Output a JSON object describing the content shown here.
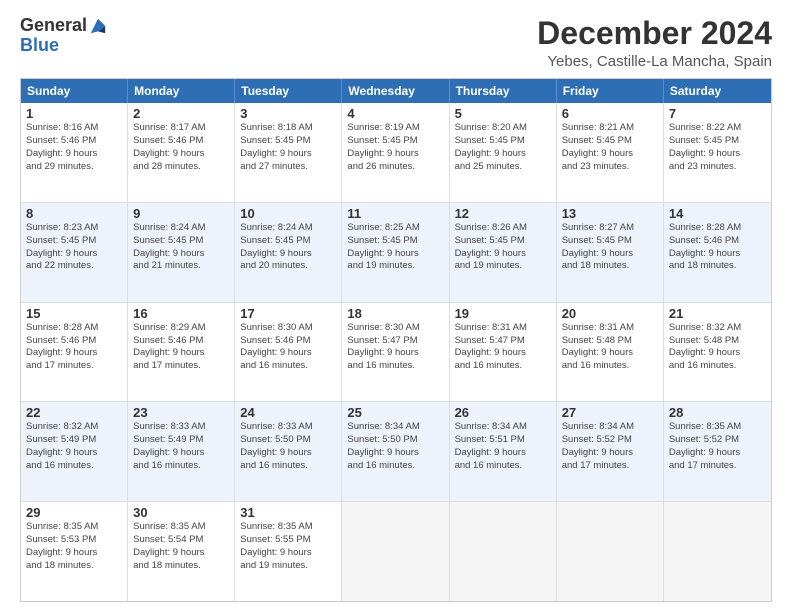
{
  "logo": {
    "line1": "General",
    "line2": "Blue"
  },
  "title": "December 2024",
  "subtitle": "Yebes, Castille-La Mancha, Spain",
  "header": {
    "days": [
      "Sunday",
      "Monday",
      "Tuesday",
      "Wednesday",
      "Thursday",
      "Friday",
      "Saturday"
    ]
  },
  "weeks": [
    {
      "alt": false,
      "cells": [
        {
          "day": "1",
          "info": "Sunrise: 8:16 AM\nSunset: 5:46 PM\nDaylight: 9 hours\nand 29 minutes."
        },
        {
          "day": "2",
          "info": "Sunrise: 8:17 AM\nSunset: 5:46 PM\nDaylight: 9 hours\nand 28 minutes."
        },
        {
          "day": "3",
          "info": "Sunrise: 8:18 AM\nSunset: 5:45 PM\nDaylight: 9 hours\nand 27 minutes."
        },
        {
          "day": "4",
          "info": "Sunrise: 8:19 AM\nSunset: 5:45 PM\nDaylight: 9 hours\nand 26 minutes."
        },
        {
          "day": "5",
          "info": "Sunrise: 8:20 AM\nSunset: 5:45 PM\nDaylight: 9 hours\nand 25 minutes."
        },
        {
          "day": "6",
          "info": "Sunrise: 8:21 AM\nSunset: 5:45 PM\nDaylight: 9 hours\nand 23 minutes."
        },
        {
          "day": "7",
          "info": "Sunrise: 8:22 AM\nSunset: 5:45 PM\nDaylight: 9 hours\nand 23 minutes."
        }
      ]
    },
    {
      "alt": true,
      "cells": [
        {
          "day": "8",
          "info": "Sunrise: 8:23 AM\nSunset: 5:45 PM\nDaylight: 9 hours\nand 22 minutes."
        },
        {
          "day": "9",
          "info": "Sunrise: 8:24 AM\nSunset: 5:45 PM\nDaylight: 9 hours\nand 21 minutes."
        },
        {
          "day": "10",
          "info": "Sunrise: 8:24 AM\nSunset: 5:45 PM\nDaylight: 9 hours\nand 20 minutes."
        },
        {
          "day": "11",
          "info": "Sunrise: 8:25 AM\nSunset: 5:45 PM\nDaylight: 9 hours\nand 19 minutes."
        },
        {
          "day": "12",
          "info": "Sunrise: 8:26 AM\nSunset: 5:45 PM\nDaylight: 9 hours\nand 19 minutes."
        },
        {
          "day": "13",
          "info": "Sunrise: 8:27 AM\nSunset: 5:45 PM\nDaylight: 9 hours\nand 18 minutes."
        },
        {
          "day": "14",
          "info": "Sunrise: 8:28 AM\nSunset: 5:46 PM\nDaylight: 9 hours\nand 18 minutes."
        }
      ]
    },
    {
      "alt": false,
      "cells": [
        {
          "day": "15",
          "info": "Sunrise: 8:28 AM\nSunset: 5:46 PM\nDaylight: 9 hours\nand 17 minutes."
        },
        {
          "day": "16",
          "info": "Sunrise: 8:29 AM\nSunset: 5:46 PM\nDaylight: 9 hours\nand 17 minutes."
        },
        {
          "day": "17",
          "info": "Sunrise: 8:30 AM\nSunset: 5:46 PM\nDaylight: 9 hours\nand 16 minutes."
        },
        {
          "day": "18",
          "info": "Sunrise: 8:30 AM\nSunset: 5:47 PM\nDaylight: 9 hours\nand 16 minutes."
        },
        {
          "day": "19",
          "info": "Sunrise: 8:31 AM\nSunset: 5:47 PM\nDaylight: 9 hours\nand 16 minutes."
        },
        {
          "day": "20",
          "info": "Sunrise: 8:31 AM\nSunset: 5:48 PM\nDaylight: 9 hours\nand 16 minutes."
        },
        {
          "day": "21",
          "info": "Sunrise: 8:32 AM\nSunset: 5:48 PM\nDaylight: 9 hours\nand 16 minutes."
        }
      ]
    },
    {
      "alt": true,
      "cells": [
        {
          "day": "22",
          "info": "Sunrise: 8:32 AM\nSunset: 5:49 PM\nDaylight: 9 hours\nand 16 minutes."
        },
        {
          "day": "23",
          "info": "Sunrise: 8:33 AM\nSunset: 5:49 PM\nDaylight: 9 hours\nand 16 minutes."
        },
        {
          "day": "24",
          "info": "Sunrise: 8:33 AM\nSunset: 5:50 PM\nDaylight: 9 hours\nand 16 minutes."
        },
        {
          "day": "25",
          "info": "Sunrise: 8:34 AM\nSunset: 5:50 PM\nDaylight: 9 hours\nand 16 minutes."
        },
        {
          "day": "26",
          "info": "Sunrise: 8:34 AM\nSunset: 5:51 PM\nDaylight: 9 hours\nand 16 minutes."
        },
        {
          "day": "27",
          "info": "Sunrise: 8:34 AM\nSunset: 5:52 PM\nDaylight: 9 hours\nand 17 minutes."
        },
        {
          "day": "28",
          "info": "Sunrise: 8:35 AM\nSunset: 5:52 PM\nDaylight: 9 hours\nand 17 minutes."
        }
      ]
    },
    {
      "alt": false,
      "cells": [
        {
          "day": "29",
          "info": "Sunrise: 8:35 AM\nSunset: 5:53 PM\nDaylight: 9 hours\nand 18 minutes."
        },
        {
          "day": "30",
          "info": "Sunrise: 8:35 AM\nSunset: 5:54 PM\nDaylight: 9 hours\nand 18 minutes."
        },
        {
          "day": "31",
          "info": "Sunrise: 8:35 AM\nSunset: 5:55 PM\nDaylight: 9 hours\nand 19 minutes."
        },
        {
          "day": "",
          "info": ""
        },
        {
          "day": "",
          "info": ""
        },
        {
          "day": "",
          "info": ""
        },
        {
          "day": "",
          "info": ""
        }
      ]
    }
  ]
}
